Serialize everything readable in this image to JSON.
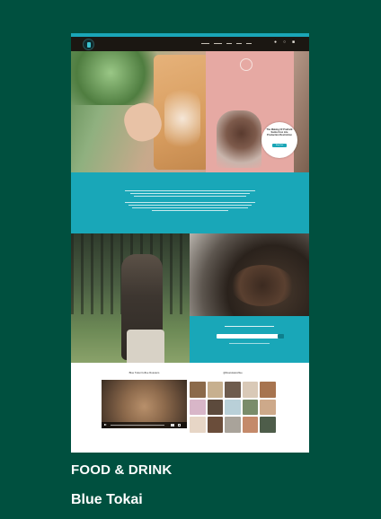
{
  "colors": {
    "page_background": "#00503f",
    "site_teal": "#19a7b8",
    "nav_dark": "#1b1712",
    "caption_text": "#ffffff"
  },
  "site": {
    "nav_icons": [
      "user-icon",
      "search-icon",
      "cart-icon"
    ]
  },
  "hero": {
    "badge_text": "The Making Of Pruthvik Santa Cruz Lite Production Restriction",
    "badge_button": "Shop Now"
  },
  "sections": {
    "video_title": "Blue Tokai Coffee Roasters",
    "instagram_title": "@bluetokaicoffee"
  },
  "instagram_tiles": [
    "#8b6a4a",
    "#c7b08f",
    "#6e5c4d",
    "#d9c9b7",
    "#a7744f",
    "#d8b6c8",
    "#5c4a3c",
    "#b9d0d8",
    "#7a8c6a",
    "#cda98a",
    "#e7d6c6",
    "#6a4d3a",
    "#a9a39a",
    "#c48a6a",
    "#4e5d4a"
  ],
  "caption": {
    "category": "FOOD & DRINK",
    "title": "Blue Tokai"
  }
}
